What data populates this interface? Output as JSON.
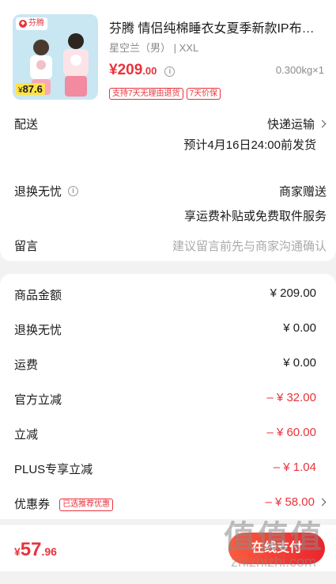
{
  "product": {
    "brand_tag": "芬腾",
    "thumb_price": "87.6",
    "title": "芬腾 情侣纯棉睡衣女夏季新款IP布…",
    "spec": "星空兰（男） | XXL",
    "price_int": "¥209",
    "price_dec": ".00",
    "weight": "0.300kg×1",
    "tags": [
      "支持7天无理由退货",
      "7天价保"
    ]
  },
  "delivery": {
    "label": "配送",
    "method": "快递运输",
    "eta": "预计4月16日24:00前发货"
  },
  "returns": {
    "label": "退换无忧",
    "value": "商家赠送",
    "desc": "享运费补贴或免费取件服务"
  },
  "message": {
    "label": "留言",
    "placeholder": "建议留言前先与商家沟通确认"
  },
  "amounts": [
    {
      "label": "商品金额",
      "value": "¥ 209.00"
    },
    {
      "label": "退换无忧",
      "value": "¥ 0.00"
    },
    {
      "label": "运费",
      "value": "¥ 0.00"
    },
    {
      "label": "官方立减",
      "value": "– ¥ 32.00"
    },
    {
      "label": "立减",
      "value": "– ¥ 60.00"
    },
    {
      "label": "PLUS专享立减",
      "value": "– ¥ 1.04"
    },
    {
      "label": "优惠券",
      "value": "– ¥ 58.00",
      "badge": "已选推荐优惠"
    }
  ],
  "footer": {
    "currency": "¥",
    "total_int": "57",
    "total_dec": ".96",
    "pay_label": "在线支付"
  },
  "watermark": {
    "logo": "值值值",
    "text": "zhizhizhi.com"
  },
  "colors": {
    "accent": "#e8333c",
    "text": "#1a1a1a",
    "muted": "#8a8a8a"
  }
}
